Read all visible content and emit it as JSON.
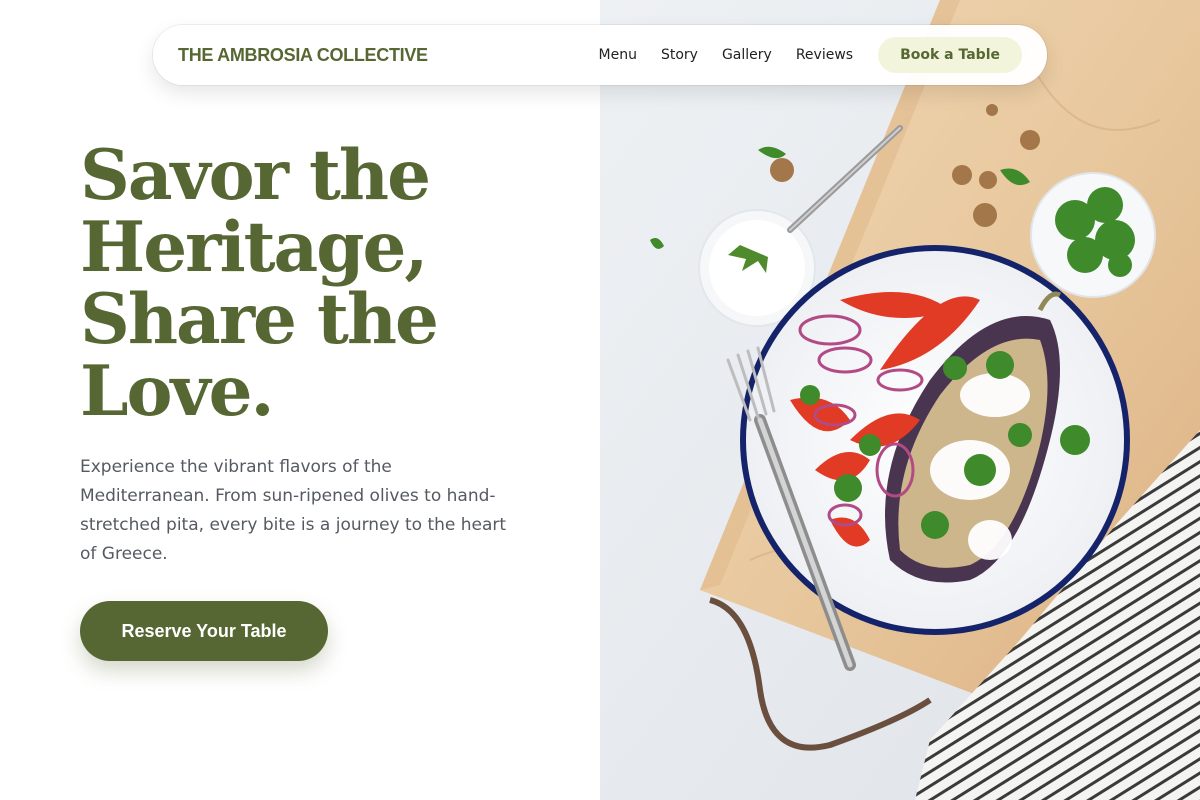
{
  "brand": {
    "name": "THE AMBROSIA COLLECTIVE",
    "color": "#566733"
  },
  "nav": {
    "links": [
      "Menu",
      "Story",
      "Gallery",
      "Reviews"
    ],
    "cta_label": "Book a Table"
  },
  "hero": {
    "title_lines": [
      "Savor the",
      "Heritage,",
      "Share the",
      "Love."
    ],
    "description": "Experience the vibrant flavors of the Mediterranean. From sun-ripened olives to hand-stretched pita, every bite is a journey to the heart of Greece.",
    "button_label": "Reserve Your Table"
  },
  "colors": {
    "accent": "#566733",
    "nav_cta_bg": "#f2f4dc",
    "text_muted": "#555a62"
  }
}
